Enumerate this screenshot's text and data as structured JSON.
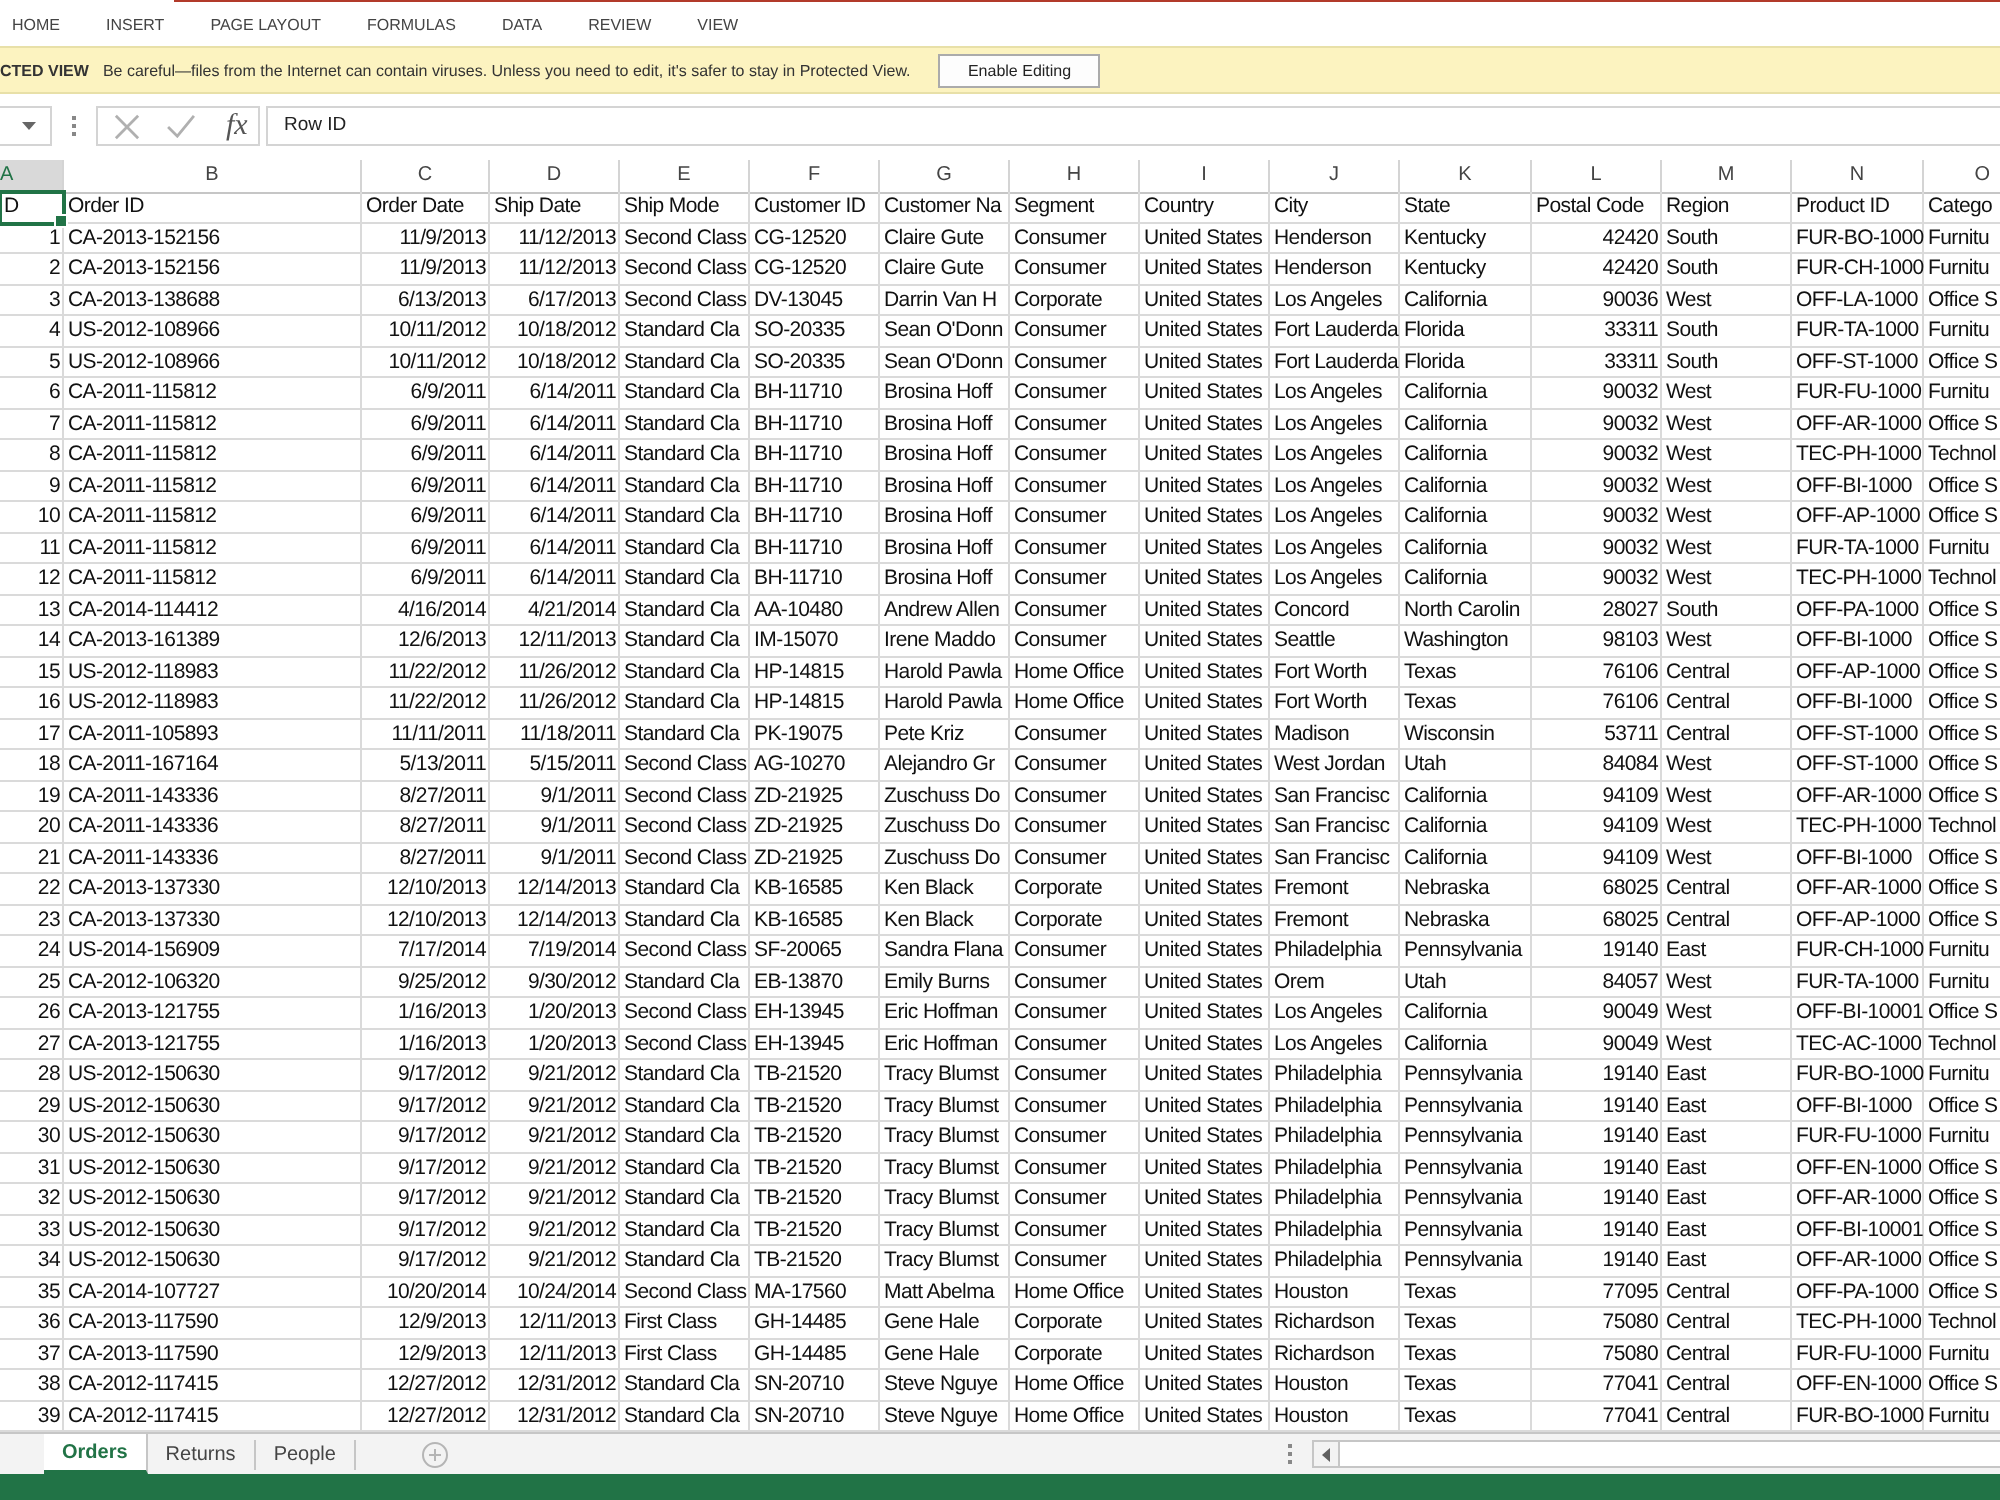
{
  "ribbon_tabs": [
    {
      "label": "HOME",
      "selected": false
    },
    {
      "label": "INSERT",
      "selected": false
    },
    {
      "label": "PAGE LAYOUT",
      "selected": false
    },
    {
      "label": "FORMULAS",
      "selected": false
    },
    {
      "label": "DATA",
      "selected": false
    },
    {
      "label": "REVIEW",
      "selected": false
    },
    {
      "label": "VIEW",
      "selected": false
    }
  ],
  "protected_view": {
    "label": "CTED VIEW",
    "message": "Be careful—files from the Internet can contain viruses. Unless you need to edit, it's safer to stay in Protected View.",
    "button": "Enable Editing"
  },
  "formula_bar": {
    "function_label": "fx",
    "value": "Row ID"
  },
  "sheet": {
    "columns": [
      {
        "letter": "A",
        "kind": "number",
        "selected": true
      },
      {
        "letter": "B",
        "kind": "text",
        "selected": false
      },
      {
        "letter": "C",
        "kind": "date",
        "selected": false
      },
      {
        "letter": "D",
        "kind": "date",
        "selected": false
      },
      {
        "letter": "E",
        "kind": "text",
        "selected": false
      },
      {
        "letter": "F",
        "kind": "text",
        "selected": false
      },
      {
        "letter": "G",
        "kind": "text",
        "selected": false
      },
      {
        "letter": "H",
        "kind": "text",
        "selected": false
      },
      {
        "letter": "I",
        "kind": "text",
        "selected": false
      },
      {
        "letter": "J",
        "kind": "text",
        "selected": false
      },
      {
        "letter": "K",
        "kind": "text",
        "selected": false
      },
      {
        "letter": "L",
        "kind": "number",
        "selected": false
      },
      {
        "letter": "M",
        "kind": "text",
        "selected": false
      },
      {
        "letter": "N",
        "kind": "text",
        "selected": false
      },
      {
        "letter": "O",
        "kind": "text",
        "selected": false
      }
    ],
    "header": [
      "D",
      "Order ID",
      "Order Date",
      "Ship Date",
      "Ship Mode",
      "Customer ID",
      "Customer Na",
      "Segment",
      "Country",
      "City",
      "State",
      "Postal Code",
      "Region",
      "Product ID",
      "Catego"
    ],
    "rows": [
      [
        "1",
        "CA-2013-152156",
        "11/9/2013",
        "11/12/2013",
        "Second Class",
        "CG-12520",
        "Claire Gute",
        "Consumer",
        "United States",
        "Henderson",
        "Kentucky",
        "42420",
        "South",
        "FUR-BO-1000",
        "Furnitu"
      ],
      [
        "2",
        "CA-2013-152156",
        "11/9/2013",
        "11/12/2013",
        "Second Class",
        "CG-12520",
        "Claire Gute",
        "Consumer",
        "United States",
        "Henderson",
        "Kentucky",
        "42420",
        "South",
        "FUR-CH-1000",
        "Furnitu"
      ],
      [
        "3",
        "CA-2013-138688",
        "6/13/2013",
        "6/17/2013",
        "Second Class",
        "DV-13045",
        "Darrin Van H",
        "Corporate",
        "United States",
        "Los Angeles",
        "California",
        "90036",
        "West",
        "OFF-LA-1000",
        "Office S"
      ],
      [
        "4",
        "US-2012-108966",
        "10/11/2012",
        "10/18/2012",
        "Standard Cla",
        "SO-20335",
        "Sean O'Donn",
        "Consumer",
        "United States",
        "Fort Lauderda",
        "Florida",
        "33311",
        "South",
        "FUR-TA-1000",
        "Furnitu"
      ],
      [
        "5",
        "US-2012-108966",
        "10/11/2012",
        "10/18/2012",
        "Standard Cla",
        "SO-20335",
        "Sean O'Donn",
        "Consumer",
        "United States",
        "Fort Lauderda",
        "Florida",
        "33311",
        "South",
        "OFF-ST-1000",
        "Office S"
      ],
      [
        "6",
        "CA-2011-115812",
        "6/9/2011",
        "6/14/2011",
        "Standard Cla",
        "BH-11710",
        "Brosina Hoff",
        "Consumer",
        "United States",
        "Los Angeles",
        "California",
        "90032",
        "West",
        "FUR-FU-1000",
        "Furnitu"
      ],
      [
        "7",
        "CA-2011-115812",
        "6/9/2011",
        "6/14/2011",
        "Standard Cla",
        "BH-11710",
        "Brosina Hoff",
        "Consumer",
        "United States",
        "Los Angeles",
        "California",
        "90032",
        "West",
        "OFF-AR-1000",
        "Office S"
      ],
      [
        "8",
        "CA-2011-115812",
        "6/9/2011",
        "6/14/2011",
        "Standard Cla",
        "BH-11710",
        "Brosina Hoff",
        "Consumer",
        "United States",
        "Los Angeles",
        "California",
        "90032",
        "West",
        "TEC-PH-1000",
        "Technol"
      ],
      [
        "9",
        "CA-2011-115812",
        "6/9/2011",
        "6/14/2011",
        "Standard Cla",
        "BH-11710",
        "Brosina Hoff",
        "Consumer",
        "United States",
        "Los Angeles",
        "California",
        "90032",
        "West",
        "OFF-BI-1000",
        "Office S"
      ],
      [
        "10",
        "CA-2011-115812",
        "6/9/2011",
        "6/14/2011",
        "Standard Cla",
        "BH-11710",
        "Brosina Hoff",
        "Consumer",
        "United States",
        "Los Angeles",
        "California",
        "90032",
        "West",
        "OFF-AP-1000",
        "Office S"
      ],
      [
        "11",
        "CA-2011-115812",
        "6/9/2011",
        "6/14/2011",
        "Standard Cla",
        "BH-11710",
        "Brosina Hoff",
        "Consumer",
        "United States",
        "Los Angeles",
        "California",
        "90032",
        "West",
        "FUR-TA-1000",
        "Furnitu"
      ],
      [
        "12",
        "CA-2011-115812",
        "6/9/2011",
        "6/14/2011",
        "Standard Cla",
        "BH-11710",
        "Brosina Hoff",
        "Consumer",
        "United States",
        "Los Angeles",
        "California",
        "90032",
        "West",
        "TEC-PH-1000",
        "Technol"
      ],
      [
        "13",
        "CA-2014-114412",
        "4/16/2014",
        "4/21/2014",
        "Standard Cla",
        "AA-10480",
        "Andrew Allen",
        "Consumer",
        "United States",
        "Concord",
        "North Carolin",
        "28027",
        "South",
        "OFF-PA-1000",
        "Office S"
      ],
      [
        "14",
        "CA-2013-161389",
        "12/6/2013",
        "12/11/2013",
        "Standard Cla",
        "IM-15070",
        "Irene Maddo",
        "Consumer",
        "United States",
        "Seattle",
        "Washington",
        "98103",
        "West",
        "OFF-BI-1000",
        "Office S"
      ],
      [
        "15",
        "US-2012-118983",
        "11/22/2012",
        "11/26/2012",
        "Standard Cla",
        "HP-14815",
        "Harold Pawla",
        "Home Office",
        "United States",
        "Fort Worth",
        "Texas",
        "76106",
        "Central",
        "OFF-AP-1000",
        "Office S"
      ],
      [
        "16",
        "US-2012-118983",
        "11/22/2012",
        "11/26/2012",
        "Standard Cla",
        "HP-14815",
        "Harold Pawla",
        "Home Office",
        "United States",
        "Fort Worth",
        "Texas",
        "76106",
        "Central",
        "OFF-BI-1000",
        "Office S"
      ],
      [
        "17",
        "CA-2011-105893",
        "11/11/2011",
        "11/18/2011",
        "Standard Cla",
        "PK-19075",
        "Pete Kriz",
        "Consumer",
        "United States",
        "Madison",
        "Wisconsin",
        "53711",
        "Central",
        "OFF-ST-1000",
        "Office S"
      ],
      [
        "18",
        "CA-2011-167164",
        "5/13/2011",
        "5/15/2011",
        "Second Class",
        "AG-10270",
        "Alejandro Gr",
        "Consumer",
        "United States",
        "West Jordan",
        "Utah",
        "84084",
        "West",
        "OFF-ST-1000",
        "Office S"
      ],
      [
        "19",
        "CA-2011-143336",
        "8/27/2011",
        "9/1/2011",
        "Second Class",
        "ZD-21925",
        "Zuschuss Do",
        "Consumer",
        "United States",
        "San Francisc",
        "California",
        "94109",
        "West",
        "OFF-AR-1000",
        "Office S"
      ],
      [
        "20",
        "CA-2011-143336",
        "8/27/2011",
        "9/1/2011",
        "Second Class",
        "ZD-21925",
        "Zuschuss Do",
        "Consumer",
        "United States",
        "San Francisc",
        "California",
        "94109",
        "West",
        "TEC-PH-1000",
        "Technol"
      ],
      [
        "21",
        "CA-2011-143336",
        "8/27/2011",
        "9/1/2011",
        "Second Class",
        "ZD-21925",
        "Zuschuss Do",
        "Consumer",
        "United States",
        "San Francisc",
        "California",
        "94109",
        "West",
        "OFF-BI-1000",
        "Office S"
      ],
      [
        "22",
        "CA-2013-137330",
        "12/10/2013",
        "12/14/2013",
        "Standard Cla",
        "KB-16585",
        "Ken Black",
        "Corporate",
        "United States",
        "Fremont",
        "Nebraska",
        "68025",
        "Central",
        "OFF-AR-1000",
        "Office S"
      ],
      [
        "23",
        "CA-2013-137330",
        "12/10/2013",
        "12/14/2013",
        "Standard Cla",
        "KB-16585",
        "Ken Black",
        "Corporate",
        "United States",
        "Fremont",
        "Nebraska",
        "68025",
        "Central",
        "OFF-AP-1000",
        "Office S"
      ],
      [
        "24",
        "US-2014-156909",
        "7/17/2014",
        "7/19/2014",
        "Second Class",
        "SF-20065",
        "Sandra Flana",
        "Consumer",
        "United States",
        "Philadelphia",
        "Pennsylvania",
        "19140",
        "East",
        "FUR-CH-1000",
        "Furnitu"
      ],
      [
        "25",
        "CA-2012-106320",
        "9/25/2012",
        "9/30/2012",
        "Standard Cla",
        "EB-13870",
        "Emily Burns",
        "Consumer",
        "United States",
        "Orem",
        "Utah",
        "84057",
        "West",
        "FUR-TA-1000",
        "Furnitu"
      ],
      [
        "26",
        "CA-2013-121755",
        "1/16/2013",
        "1/20/2013",
        "Second Class",
        "EH-13945",
        "Eric Hoffman",
        "Consumer",
        "United States",
        "Los Angeles",
        "California",
        "90049",
        "West",
        "OFF-BI-10001",
        "Office S"
      ],
      [
        "27",
        "CA-2013-121755",
        "1/16/2013",
        "1/20/2013",
        "Second Class",
        "EH-13945",
        "Eric Hoffman",
        "Consumer",
        "United States",
        "Los Angeles",
        "California",
        "90049",
        "West",
        "TEC-AC-1000",
        "Technol"
      ],
      [
        "28",
        "US-2012-150630",
        "9/17/2012",
        "9/21/2012",
        "Standard Cla",
        "TB-21520",
        "Tracy Blumst",
        "Consumer",
        "United States",
        "Philadelphia",
        "Pennsylvania",
        "19140",
        "East",
        "FUR-BO-1000",
        "Furnitu"
      ],
      [
        "29",
        "US-2012-150630",
        "9/17/2012",
        "9/21/2012",
        "Standard Cla",
        "TB-21520",
        "Tracy Blumst",
        "Consumer",
        "United States",
        "Philadelphia",
        "Pennsylvania",
        "19140",
        "East",
        "OFF-BI-1000",
        "Office S"
      ],
      [
        "30",
        "US-2012-150630",
        "9/17/2012",
        "9/21/2012",
        "Standard Cla",
        "TB-21520",
        "Tracy Blumst",
        "Consumer",
        "United States",
        "Philadelphia",
        "Pennsylvania",
        "19140",
        "East",
        "FUR-FU-1000",
        "Furnitu"
      ],
      [
        "31",
        "US-2012-150630",
        "9/17/2012",
        "9/21/2012",
        "Standard Cla",
        "TB-21520",
        "Tracy Blumst",
        "Consumer",
        "United States",
        "Philadelphia",
        "Pennsylvania",
        "19140",
        "East",
        "OFF-EN-1000",
        "Office S"
      ],
      [
        "32",
        "US-2012-150630",
        "9/17/2012",
        "9/21/2012",
        "Standard Cla",
        "TB-21520",
        "Tracy Blumst",
        "Consumer",
        "United States",
        "Philadelphia",
        "Pennsylvania",
        "19140",
        "East",
        "OFF-AR-1000",
        "Office S"
      ],
      [
        "33",
        "US-2012-150630",
        "9/17/2012",
        "9/21/2012",
        "Standard Cla",
        "TB-21520",
        "Tracy Blumst",
        "Consumer",
        "United States",
        "Philadelphia",
        "Pennsylvania",
        "19140",
        "East",
        "OFF-BI-10001",
        "Office S"
      ],
      [
        "34",
        "US-2012-150630",
        "9/17/2012",
        "9/21/2012",
        "Standard Cla",
        "TB-21520",
        "Tracy Blumst",
        "Consumer",
        "United States",
        "Philadelphia",
        "Pennsylvania",
        "19140",
        "East",
        "OFF-AR-1000",
        "Office S"
      ],
      [
        "35",
        "CA-2014-107727",
        "10/20/2014",
        "10/24/2014",
        "Second Class",
        "MA-17560",
        "Matt Abelma",
        "Home Office",
        "United States",
        "Houston",
        "Texas",
        "77095",
        "Central",
        "OFF-PA-1000",
        "Office S"
      ],
      [
        "36",
        "CA-2013-117590",
        "12/9/2013",
        "12/11/2013",
        "First Class",
        "GH-14485",
        "Gene Hale",
        "Corporate",
        "United States",
        "Richardson",
        "Texas",
        "75080",
        "Central",
        "TEC-PH-1000",
        "Technol"
      ],
      [
        "37",
        "CA-2013-117590",
        "12/9/2013",
        "12/11/2013",
        "First Class",
        "GH-14485",
        "Gene Hale",
        "Corporate",
        "United States",
        "Richardson",
        "Texas",
        "75080",
        "Central",
        "FUR-FU-1000",
        "Furnitu"
      ],
      [
        "38",
        "CA-2012-117415",
        "12/27/2012",
        "12/31/2012",
        "Standard Cla",
        "SN-20710",
        "Steve Nguye",
        "Home Office",
        "United States",
        "Houston",
        "Texas",
        "77041",
        "Central",
        "OFF-EN-1000",
        "Office S"
      ],
      [
        "39",
        "CA-2012-117415",
        "12/27/2012",
        "12/31/2012",
        "Standard Cla",
        "SN-20710",
        "Steve Nguye",
        "Home Office",
        "United States",
        "Houston",
        "Texas",
        "77041",
        "Central",
        "FUR-BO-1000",
        "Furnitu"
      ]
    ]
  },
  "sheet_tabs": [
    {
      "label": "Orders",
      "selected": true
    },
    {
      "label": "Returns",
      "selected": false
    },
    {
      "label": "People",
      "selected": false
    }
  ]
}
